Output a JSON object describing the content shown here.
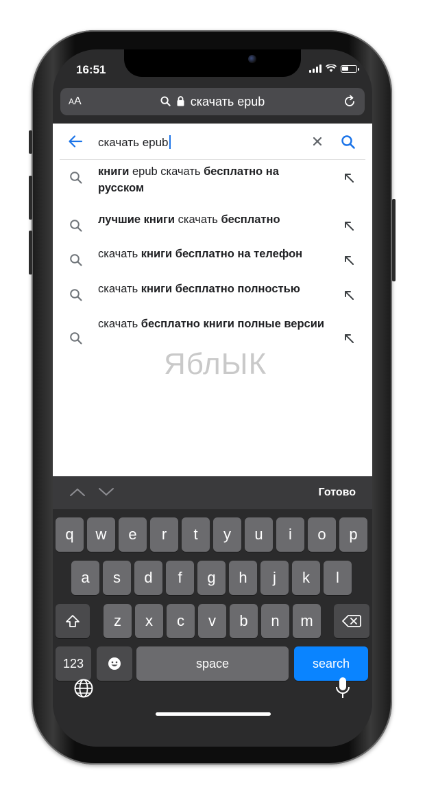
{
  "status": {
    "time": "16:51"
  },
  "url_bar": {
    "text_size_small": "A",
    "text_size_large": "A",
    "url_text": "скачать epub"
  },
  "search": {
    "query": "скачать epub",
    "suggestions": [
      {
        "parts": [
          {
            "t": "книги",
            "b": true
          },
          {
            "t": " epub скачать ",
            "b": false
          },
          {
            "t": "бесплатно на русском",
            "b": true
          }
        ]
      },
      {
        "parts": [
          {
            "t": "лучшие книги",
            "b": true
          },
          {
            "t": " скачать ",
            "b": false
          },
          {
            "t": "бесплатно",
            "b": true
          }
        ]
      },
      {
        "parts": [
          {
            "t": "скачать ",
            "b": false
          },
          {
            "t": "книги бесплатно на телефон",
            "b": true
          }
        ]
      },
      {
        "parts": [
          {
            "t": "скачать ",
            "b": false
          },
          {
            "t": "книги бесплатно полностью",
            "b": true
          }
        ]
      },
      {
        "parts": [
          {
            "t": "скачать ",
            "b": false
          },
          {
            "t": "бесплатно книги полные версии",
            "b": true
          }
        ]
      }
    ]
  },
  "watermark": "ЯблЫК",
  "accessory": {
    "done_label": "Готово"
  },
  "keyboard": {
    "row1": [
      "q",
      "w",
      "e",
      "r",
      "t",
      "y",
      "u",
      "i",
      "o",
      "p"
    ],
    "row2": [
      "a",
      "s",
      "d",
      "f",
      "g",
      "h",
      "j",
      "k",
      "l"
    ],
    "row3": [
      "z",
      "x",
      "c",
      "v",
      "b",
      "n",
      "m"
    ],
    "numbers_label": "123",
    "space_label": "space",
    "search_label": "search"
  },
  "colors": {
    "accent": "#1a73e8",
    "ios_blue": "#0a84ff",
    "key": "#6b6b6e",
    "key_dark": "#4a4a4c"
  },
  "icons": [
    "search-icon",
    "lock-icon",
    "reload-icon",
    "back-arrow-icon",
    "clear-icon",
    "fill-arrow-icon",
    "chevron-up-icon",
    "chevron-down-icon",
    "shift-icon",
    "delete-icon",
    "emoji-icon",
    "globe-icon",
    "microphone-icon"
  ]
}
